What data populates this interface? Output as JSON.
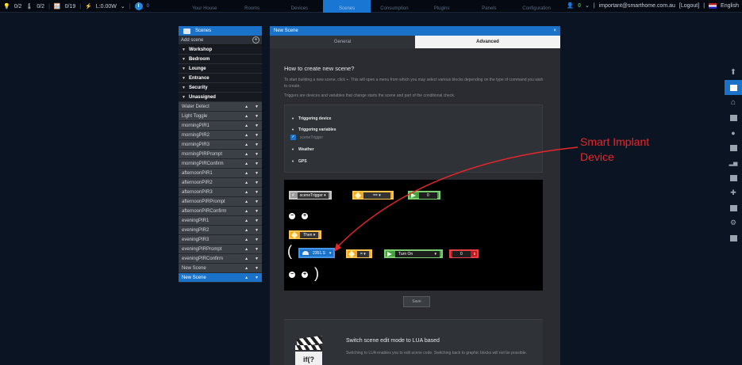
{
  "topbar": {
    "bulbs": "0/2",
    "temp": "0/2",
    "blinds": "0/19",
    "power": "L:0.00W",
    "info_count": "0",
    "nav": [
      "Your House",
      "Rooms",
      "Devices",
      "Scenes",
      "Consumption",
      "Plugins",
      "Panels",
      "Configuration"
    ],
    "active_nav": "Scenes",
    "user_badge": "0",
    "user": "important@smarthome.com.au",
    "logout": "[Logout]",
    "language": "English"
  },
  "sidebar": {
    "title": "Scenes",
    "add_label": "Add scene",
    "groups": [
      "Workshop",
      "Bedroom",
      "Lounge",
      "Entrance",
      "Security",
      "Unassigned"
    ],
    "scenes": [
      "Water Detect",
      "Light Toggle",
      "morningPIR1",
      "morningPIR2",
      "morningPIR3",
      "morningPIRPrompt",
      "morningPIRConfirm",
      "afternoonPIR1",
      "afternoonPIR2",
      "afternoonPIR3",
      "afternoonPIRPrompt",
      "afternoonPIRConfirm",
      "eveningPIR1",
      "eveningPIR2",
      "eveningPIR3",
      "eveningPIRPrompt",
      "eveningPIRConfirm",
      "New Scene",
      "New Scene"
    ],
    "active_scene_index": 18
  },
  "panel": {
    "title": "New Scene",
    "close": "×",
    "tabs": [
      "General",
      "Advanced"
    ],
    "active_tab": "Advanced",
    "heading": "How to create new scene?",
    "para1": "To start building a new scene, click +. This will open a menu from which you may select various blocks depending on the type of command you wish to create.",
    "para2": "Triggers are devices and variables that change starts the scene and part of the conditional check.",
    "triggers": {
      "device": "Triggering device",
      "variables": "Triggering variables",
      "variable_item": "sceneTrigger",
      "weather": "Weather",
      "gps": "GPS"
    },
    "editor": {
      "trigger_var": "sceneTrigger",
      "cond_op": "==",
      "cond_value": "0",
      "then_label": "Then",
      "device": "2351.S",
      "action_op": "=",
      "action": "Turn On",
      "delay_value": "0",
      "delay_unit": "s"
    },
    "save": "Save",
    "lua": {
      "title": "Switch scene edit mode to LUA based",
      "text": "Switching to LUA enables you to edit scene code. Switching back to graphic blocks will not be possible.",
      "icon_text": "if(?"
    }
  },
  "annotation": {
    "text_line1": "Smart Implant",
    "text_line2": "Device",
    "color": "#e8262b"
  },
  "colors": {
    "accent": "#1b73c9",
    "background": "#0b1422"
  }
}
